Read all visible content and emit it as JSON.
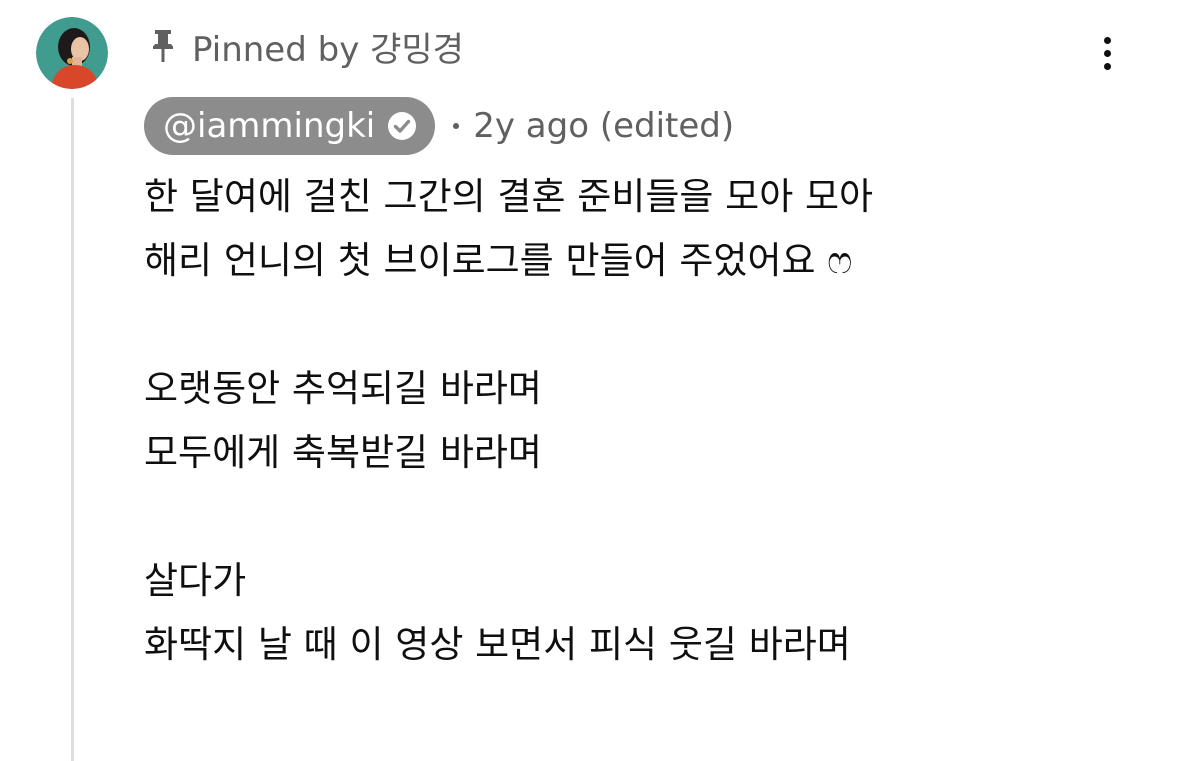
{
  "comment": {
    "pinned_label": "Pinned by 걍밍경",
    "author": "@iammingki",
    "author_verified": true,
    "timestamp": "2y ago (edited)",
    "body_lines": [
      "한 달여에 걸친 그간의 결혼 준비들을 모아 모아",
      "해리 언니의 첫 브이로그를 만들어 주었어요 ෆ",
      "",
      "오랫동안 추억되길 바라며",
      "모두에게 축복받길 바라며",
      "",
      "살다가",
      "화딱지 날 때 이 영상 보면서 피식 웃길 바라며"
    ]
  },
  "icons": {
    "pin": "pin-icon",
    "verified": "verified-check-icon",
    "more": "more-vertical-icon",
    "avatar": "avatar"
  },
  "colors": {
    "text_primary": "#0f0f0f",
    "text_secondary": "#606060",
    "author_chip_bg": "#8c8c8c",
    "thread_line": "#dedede"
  }
}
